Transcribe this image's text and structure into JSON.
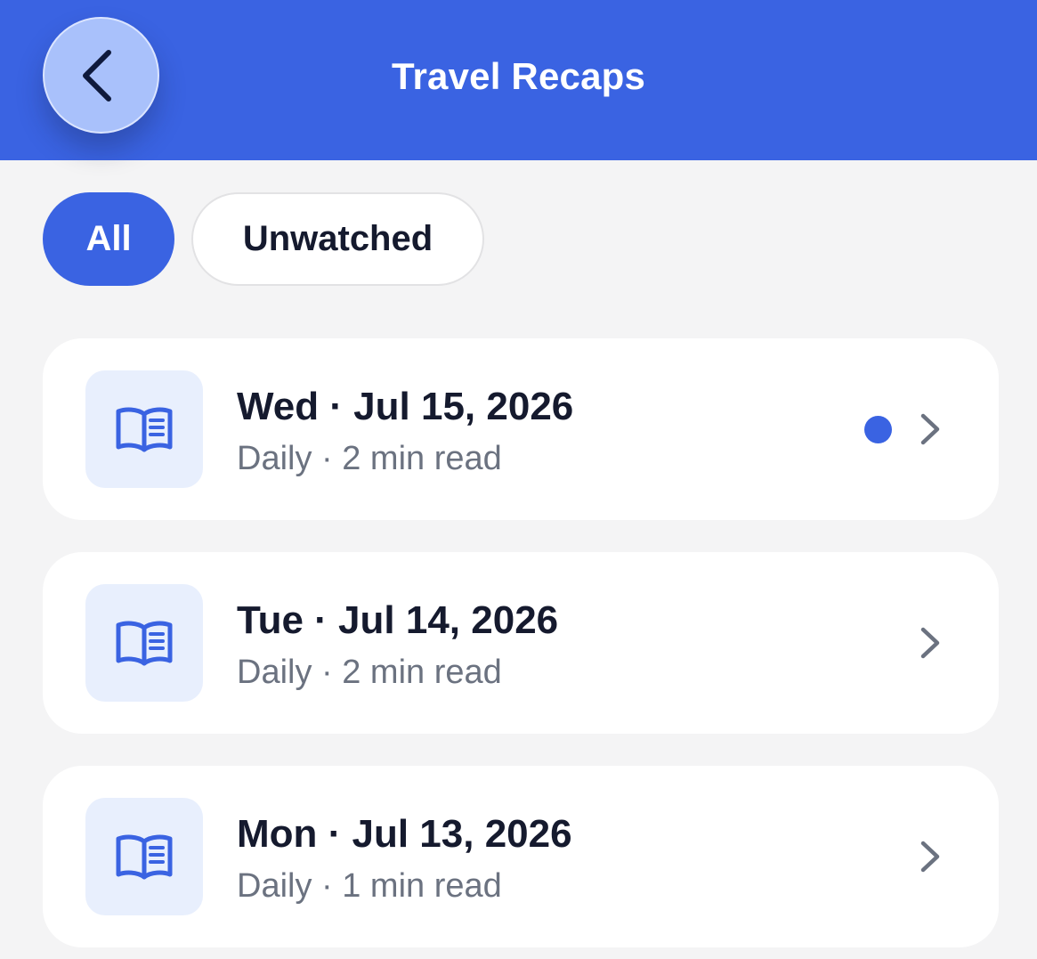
{
  "header": {
    "title": "Travel Recaps",
    "back_icon": "chevron-left-icon"
  },
  "filters": [
    {
      "label": "All",
      "selected": true
    },
    {
      "label": "Unwatched",
      "selected": false
    }
  ],
  "recaps": [
    {
      "title": "Wed · Jul 15, 2026",
      "subtitle": "Daily · 2 min read",
      "unread": true,
      "icon": "book-icon"
    },
    {
      "title": "Tue · Jul 14, 2026",
      "subtitle": "Daily · 2 min read",
      "unread": false,
      "icon": "book-icon"
    },
    {
      "title": "Mon · Jul 13, 2026",
      "subtitle": "Daily · 1 min read",
      "unread": false,
      "icon": "book-icon"
    }
  ],
  "colors": {
    "accent": "#3a63e2",
    "background": "#f4f4f5",
    "icon_tile": "#e8effd",
    "text_primary": "#151a2e",
    "text_secondary": "#6b7280",
    "chevron": "#6b7280"
  }
}
